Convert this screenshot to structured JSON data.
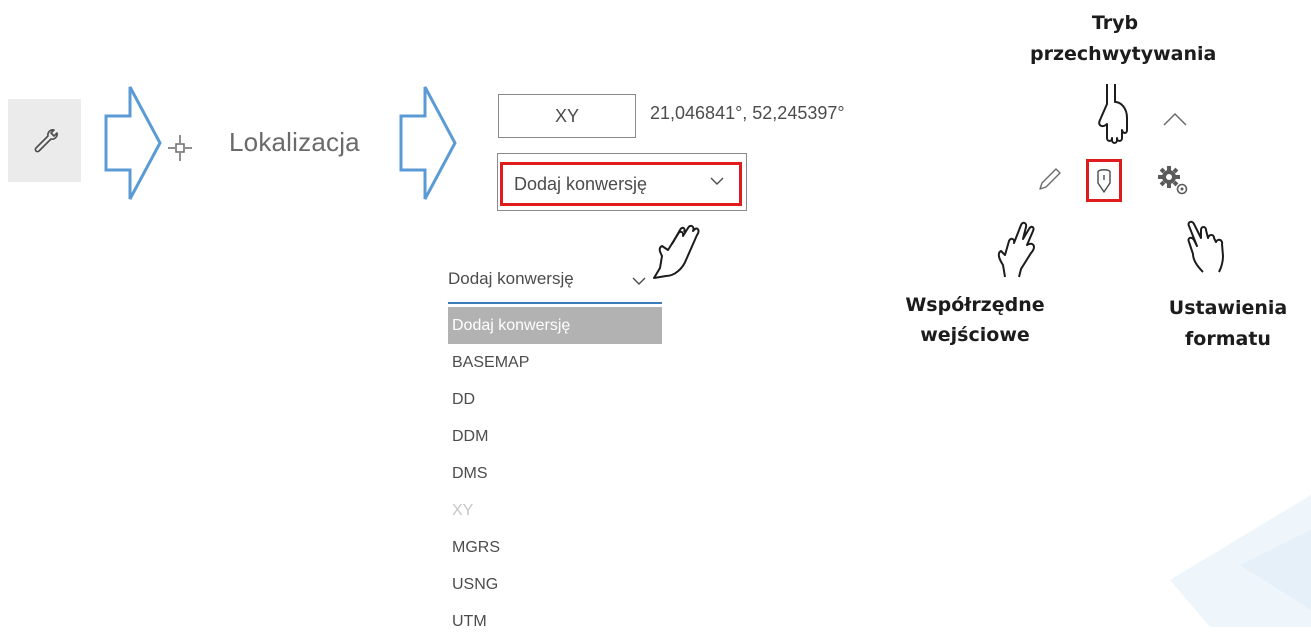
{
  "toolbar": {
    "tool_icon": "wrench-icon",
    "location_label": "Lokalizacja",
    "crosshair_icon": "crosshair-icon"
  },
  "coordinate_panel": {
    "format_button_label": "XY",
    "coordinate_value": "21,046841°, 52,245397°",
    "add_conversion_label": "Dodaj konwersję"
  },
  "dropdown_expanded": {
    "selected_label": "Dodaj konwersję",
    "options": [
      {
        "label": "Dodaj konwersję",
        "state": "selected"
      },
      {
        "label": "BASEMAP",
        "state": "normal"
      },
      {
        "label": "DD",
        "state": "normal"
      },
      {
        "label": "DDM",
        "state": "normal"
      },
      {
        "label": "DMS",
        "state": "normal"
      },
      {
        "label": "XY",
        "state": "disabled"
      },
      {
        "label": "MGRS",
        "state": "normal"
      },
      {
        "label": "USNG",
        "state": "normal"
      },
      {
        "label": "UTM",
        "state": "normal"
      }
    ]
  },
  "right_tools": {
    "collapse_icon": "chevron-up-icon",
    "input_icon": "pencil-icon",
    "capture_icon": "map-pin-icon",
    "settings_icon": "gears-icon"
  },
  "annotations": {
    "tryb": "Tryb przechwytywania",
    "wspolrzedne": "Współrzędne wejściowe",
    "ustawienia": "Ustawienia formatu"
  },
  "colors": {
    "highlight_red": "#e01c1c",
    "arrow_blue": "#5b9bd5",
    "focus_blue": "#3b7cb8",
    "selected_gray": "#b2b2b2"
  }
}
